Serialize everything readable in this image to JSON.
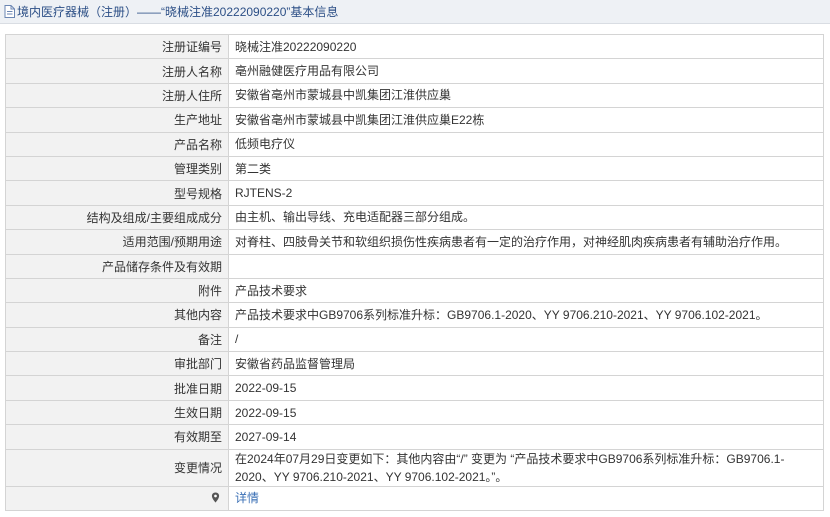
{
  "header": {
    "title": "境内医疗器械（注册）——“晓械注准20222090220”基本信息"
  },
  "rows": [
    {
      "label": "注册证编号",
      "value": "晓械注准20222090220"
    },
    {
      "label": "注册人名称",
      "value": "亳州融健医疗用品有限公司"
    },
    {
      "label": "注册人住所",
      "value": "安徽省亳州市蒙城县中凯集团江淮供应巢"
    },
    {
      "label": "生产地址",
      "value": "安徽省亳州市蒙城县中凯集团江淮供应巢E22栋"
    },
    {
      "label": "产品名称",
      "value": "低频电疗仪"
    },
    {
      "label": "管理类别",
      "value": "第二类"
    },
    {
      "label": "型号规格",
      "value": "RJTENS-2"
    },
    {
      "label": "结构及组成/主要组成成分",
      "value": "由主机、输出导线、充电适配器三部分组成。"
    },
    {
      "label": "适用范围/预期用途",
      "value": "对脊柱、四肢骨关节和软组织损伤性疾病患者有一定的治疗作用，对神经肌肉疾病患者有辅助治疗作用。"
    },
    {
      "label": "产品储存条件及有效期",
      "value": ""
    },
    {
      "label": "附件",
      "value": "产品技术要求"
    },
    {
      "label": "其他内容",
      "value": "产品技术要求中GB9706系列标准升标：GB9706.1-2020、YY 9706.210-2021、YY 9706.102-2021。"
    },
    {
      "label": "备注",
      "value": "/"
    },
    {
      "label": "审批部门",
      "value": "安徽省药品监督管理局"
    },
    {
      "label": "批准日期",
      "value": "2022-09-15"
    },
    {
      "label": "生效日期",
      "value": "2022-09-15"
    },
    {
      "label": "有效期至",
      "value": "2027-09-14"
    },
    {
      "label": "变更情况",
      "value": "在2024年07月29日变更如下：其他内容由“/” 变更为 “产品技术要求中GB9706系列标准升标：GB9706.1-2020、YY 9706.210-2021、YY 9706.102-2021。”。"
    }
  ],
  "footer_row": {
    "label_icon": "location-pin-icon",
    "link_text": "详情"
  }
}
